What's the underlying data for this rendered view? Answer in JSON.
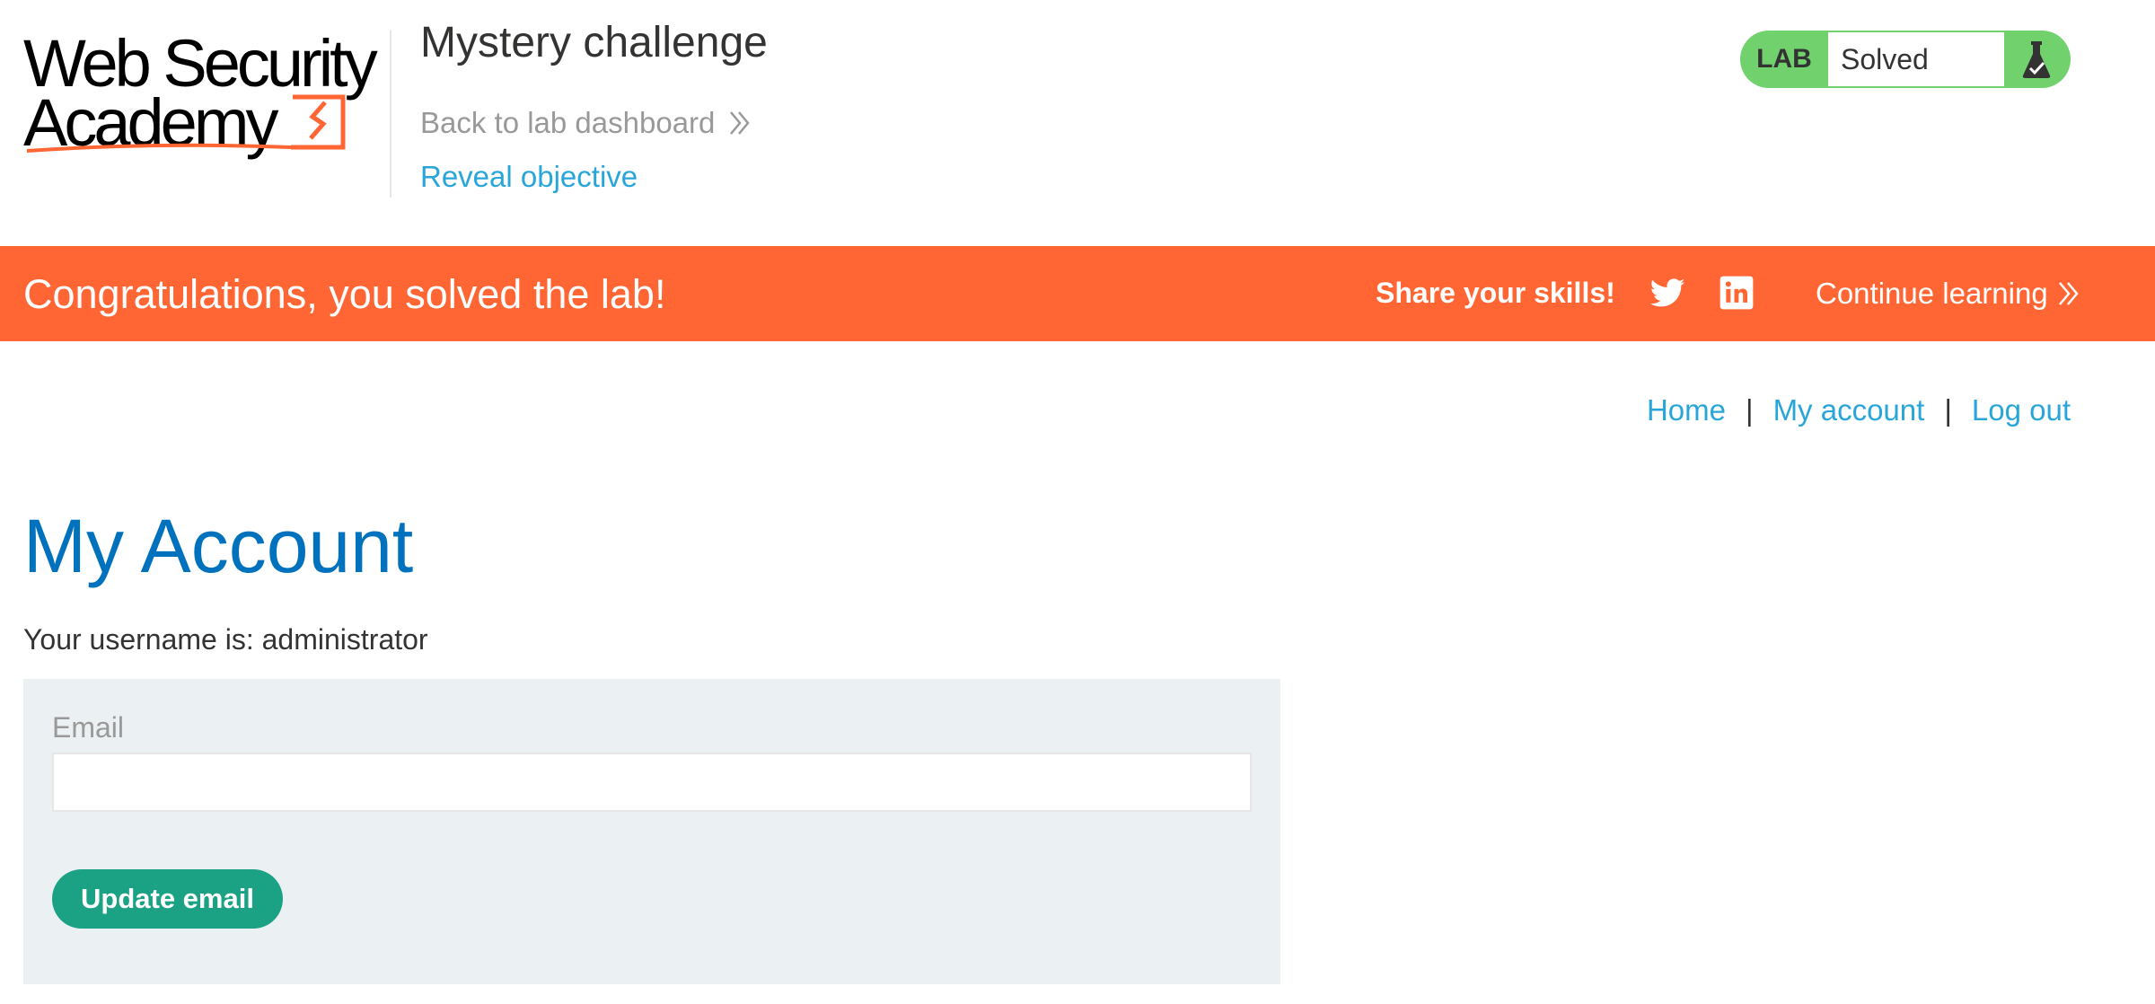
{
  "logo": {
    "line1": "Web Security",
    "line2": "Academy",
    "alt": "Web Security Academy logo"
  },
  "header": {
    "lab_title": "Mystery challenge",
    "back_link": "Back to lab dashboard",
    "reveal_link": "Reveal objective"
  },
  "lab_status": {
    "label": "LAB",
    "status": "Solved",
    "icon": "flask-icon"
  },
  "banner": {
    "message": "Congratulations, you solved the lab!",
    "share": "Share your skills!",
    "twitter_icon": "twitter-icon",
    "linkedin_icon": "linkedin-icon",
    "continue": "Continue learning"
  },
  "nav": {
    "home": "Home",
    "account": "My account",
    "logout": "Log out",
    "separator": "|"
  },
  "main": {
    "title": "My Account",
    "username_text": "Your username is: administrator",
    "email_label": "Email",
    "email_value": "",
    "update_button": "Update email"
  },
  "colors": {
    "banner": "#ff6633",
    "link": "#29a6d9",
    "title": "#0071bc",
    "badge": "#70d16d",
    "button": "#1ba184",
    "panel": "#ebf0f2"
  }
}
